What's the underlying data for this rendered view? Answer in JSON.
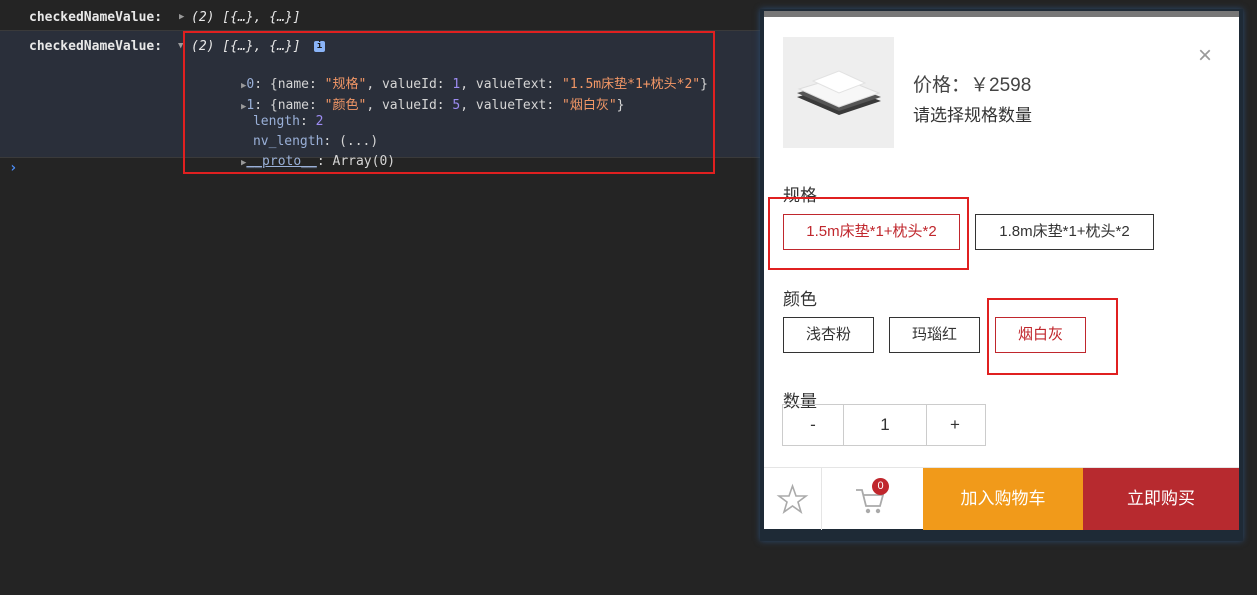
{
  "console": {
    "row1": {
      "key": "checkedNameValue:",
      "summary": "(2) [{…}, {…}]"
    },
    "row2": {
      "key": "checkedNameValue:",
      "summary": "(2) [{…}, {…}]",
      "info_badge": "i",
      "items": [
        {
          "index": "0",
          "open": "{name: ",
          "name": "\"规格\"",
          "mid": ", valueId: ",
          "valueId": "1",
          "mid2": ", valueText: ",
          "valueText": "\"1.5m床垫*1+枕头*2\"",
          "close": "}"
        },
        {
          "index": "1",
          "open": "{name: ",
          "name": "\"颜色\"",
          "mid": ", valueId: ",
          "valueId": "5",
          "mid2": ", valueText: ",
          "valueText": "\"烟白灰\"",
          "close": "}"
        }
      ],
      "length_key": "length",
      "length_value": "2",
      "nv_key": "nv_length",
      "nv_value": "(...)",
      "proto_key": "__proto__",
      "proto_value": "Array(0)"
    },
    "prompt": "›"
  },
  "product": {
    "price": "价格：￥2598",
    "hint": "请选择规格数量",
    "close_glyph": "×",
    "spec_label": "规格",
    "spec_options": [
      "1.5m床垫*1+枕头*2",
      "1.8m床垫*1+枕头*2"
    ],
    "spec_selected": 0,
    "color_label": "颜色",
    "color_options": [
      "浅杏粉",
      "玛瑙红",
      "烟白灰"
    ],
    "color_selected": 2,
    "qty_label": "数量",
    "qty_minus": "-",
    "qty_value": "1",
    "qty_plus": "+",
    "cart_count": "0",
    "add_to_cart": "加入购物车",
    "buy_now": "立即购买"
  },
  "colors": {
    "accent_red": "#c0272d",
    "orange": "#f19a1a",
    "buy_red": "#b72a2f",
    "console_bg": "#242424"
  }
}
